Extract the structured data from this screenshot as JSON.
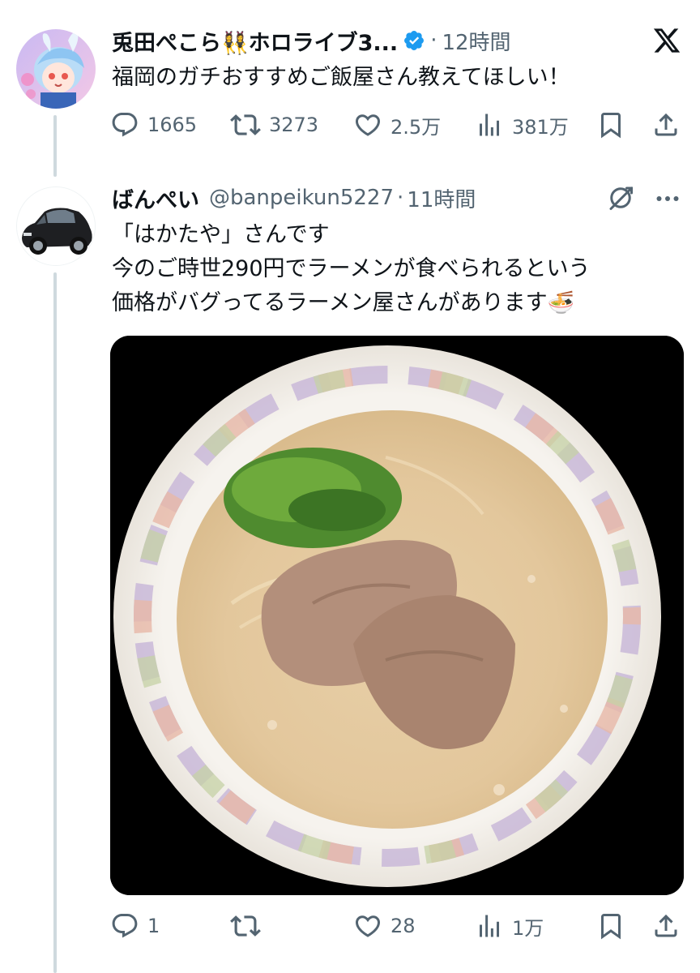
{
  "tweet1": {
    "display_name": "兎田ぺこら👯‍♀️ホロライブ3...",
    "verified": true,
    "time": "12時間",
    "text": "福岡のガチおすすめご飯屋さん教えてほしい！",
    "stats": {
      "replies": "1665",
      "retweets": "3273",
      "likes": "2.5万",
      "views": "381万"
    }
  },
  "tweet2": {
    "display_name": "ばんぺい",
    "handle": "@banpeikun5227",
    "time": "11時間",
    "lines": [
      "「はかたや」さんです",
      "今のご時世290円でラーメンが食べられるという",
      "価格がバグってるラーメン屋さんがあります🍜"
    ],
    "stats": {
      "replies": "1",
      "likes": "28",
      "views": "1万"
    }
  },
  "icons": {
    "verified": "verified-badge-icon",
    "close": "x-logo-icon",
    "reply": "reply-icon",
    "retweet": "retweet-icon",
    "like": "like-icon",
    "views": "views-icon",
    "bookmark": "bookmark-icon",
    "share": "share-icon",
    "grok": "grok-icon",
    "more": "more-icon"
  },
  "colors": {
    "verified": "#1d9bf0",
    "secondary_text": "#536471",
    "thread_line": "#cfd9de"
  }
}
